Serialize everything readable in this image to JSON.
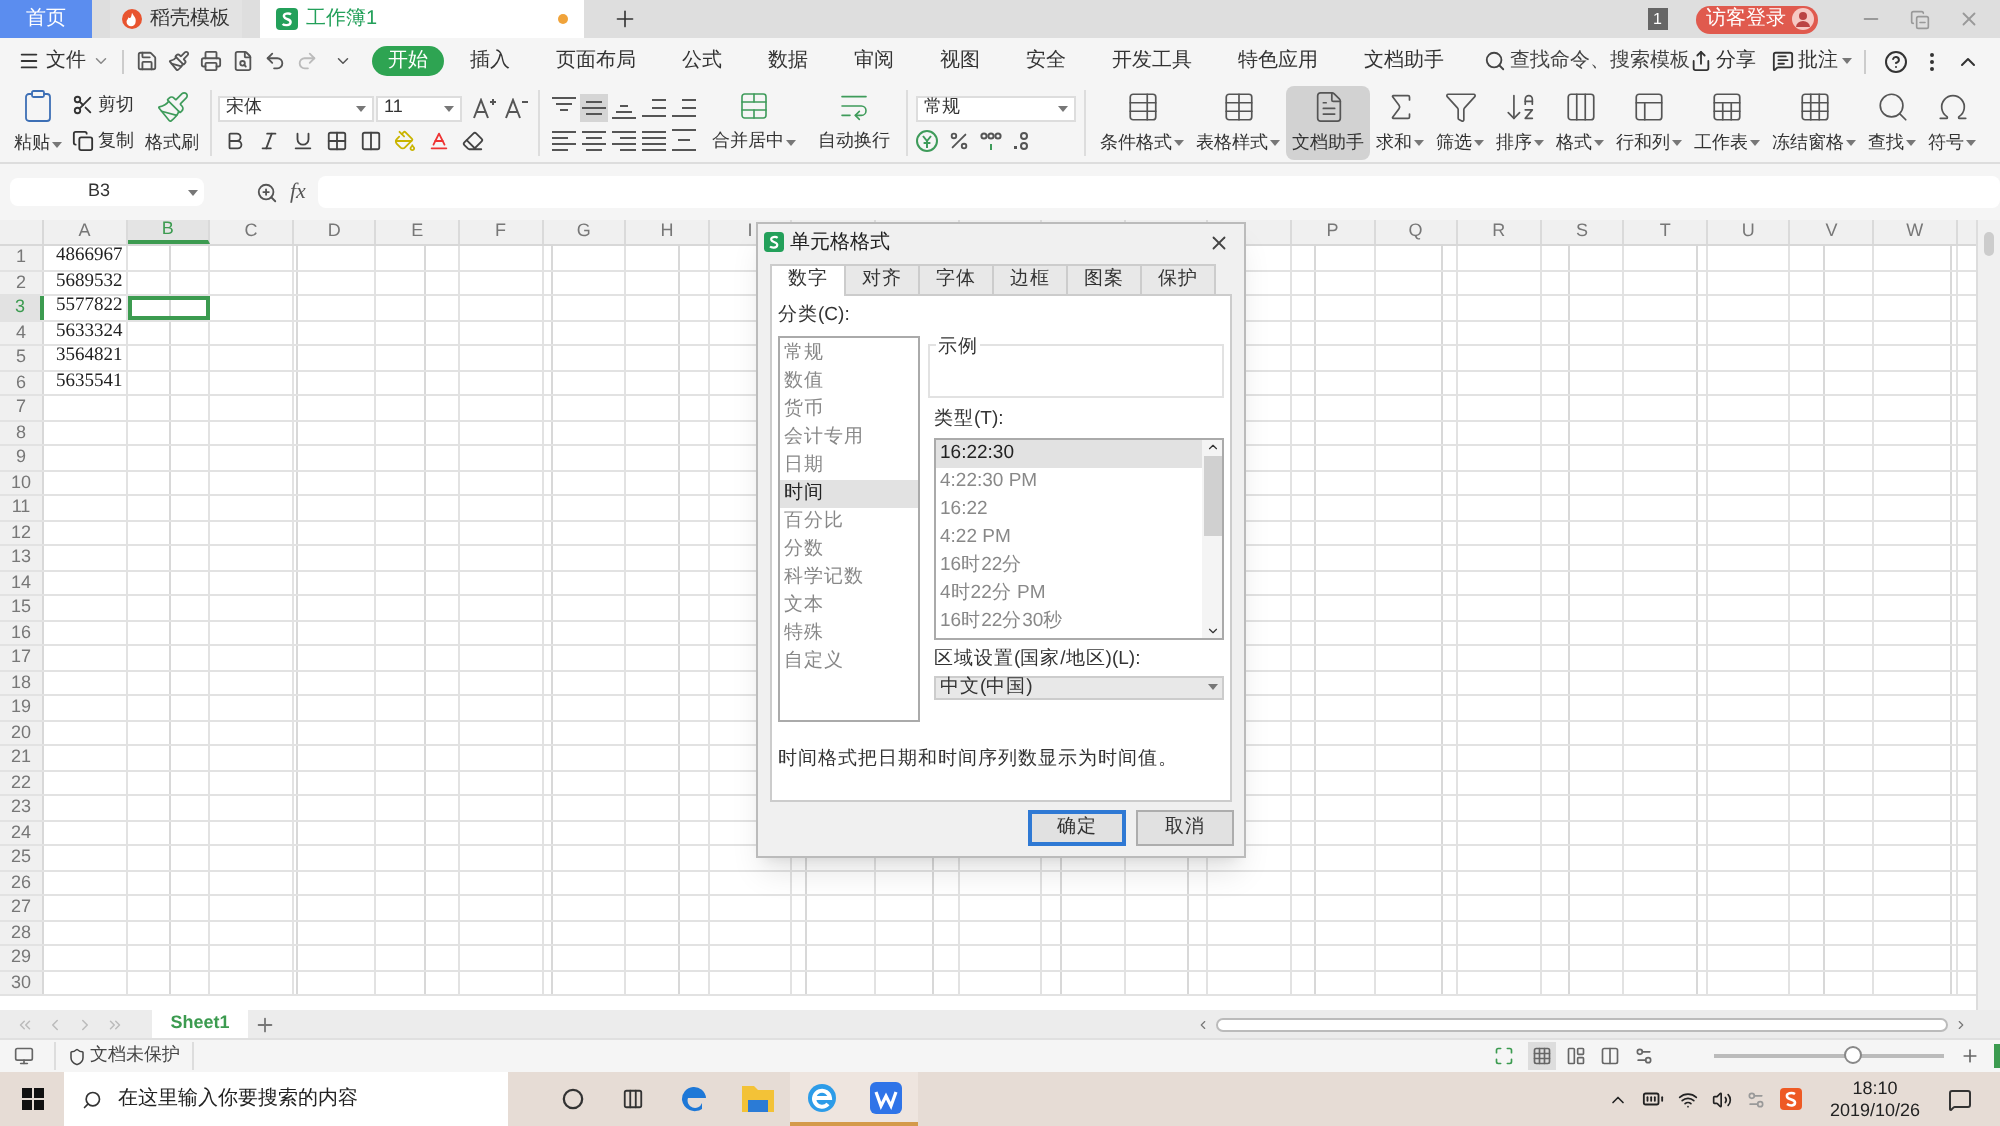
{
  "doc_tabs": [
    {
      "label": "首页",
      "kind": "home",
      "selected": false,
      "unsaved": false
    },
    {
      "label": "稻壳模板",
      "kind": "docer",
      "selected": false,
      "unsaved": false
    },
    {
      "label": "工作簿1",
      "kind": "sheet",
      "selected": true,
      "unsaved": true
    }
  ],
  "window_count": "1",
  "login": "访客登录",
  "menu": {
    "file": "文件",
    "search": "查找命令、搜索模板",
    "share": "分享",
    "comment": "批注",
    "tabs": [
      {
        "label": "开始",
        "selected": true
      },
      {
        "label": "插入",
        "selected": false
      },
      {
        "label": "页面布局",
        "selected": false
      },
      {
        "label": "公式",
        "selected": false
      },
      {
        "label": "数据",
        "selected": false
      },
      {
        "label": "审阅",
        "selected": false
      },
      {
        "label": "视图",
        "selected": false
      },
      {
        "label": "安全",
        "selected": false
      },
      {
        "label": "开发工具",
        "selected": false
      },
      {
        "label": "特色应用",
        "selected": false
      },
      {
        "label": "文档助手",
        "selected": false
      }
    ]
  },
  "ribbon": {
    "paste": {
      "label": "粘贴",
      "dropdown": true
    },
    "cut": "剪切",
    "copy": "复制",
    "format_painter": "格式刷",
    "font_name": "宋体",
    "font_size": "11",
    "align_buttons": [
      {
        "kind": "top",
        "selected": false
      },
      {
        "kind": "middle",
        "selected": true
      },
      {
        "kind": "bottom",
        "selected": false
      },
      {
        "kind": "outdent",
        "selected": false
      },
      {
        "kind": "indent",
        "selected": false
      },
      {
        "kind": "left",
        "selected": false
      },
      {
        "kind": "center",
        "selected": false
      },
      {
        "kind": "right",
        "selected": false
      },
      {
        "kind": "justify",
        "selected": false
      },
      {
        "kind": "distribute",
        "selected": false
      }
    ],
    "merge": [
      {
        "label": "合并居中",
        "kind": "merge",
        "dropdown": true
      },
      {
        "label": "自动换行",
        "kind": "wrap",
        "dropdown": false
      }
    ],
    "number_format": "常规",
    "tools": [
      {
        "label": "条件格式",
        "kind": "conditional",
        "dropdown": true,
        "selected": false
      },
      {
        "label": "表格样式",
        "kind": "table_style",
        "dropdown": true,
        "selected": false
      },
      {
        "label": "文档助手",
        "kind": "assistant",
        "dropdown": false,
        "selected": true
      },
      {
        "label": "求和",
        "kind": "sum",
        "dropdown": true,
        "selected": false
      },
      {
        "label": "筛选",
        "kind": "filter",
        "dropdown": true,
        "selected": false
      },
      {
        "label": "排序",
        "kind": "sort",
        "dropdown": true,
        "selected": false
      },
      {
        "label": "格式",
        "kind": "format",
        "dropdown": true,
        "selected": false
      },
      {
        "label": "行和列",
        "kind": "rowcol",
        "dropdown": true,
        "selected": false
      },
      {
        "label": "工作表",
        "kind": "sheet",
        "dropdown": true,
        "selected": false
      },
      {
        "label": "冻结窗格",
        "kind": "freeze",
        "dropdown": true,
        "selected": false
      },
      {
        "label": "查找",
        "kind": "find",
        "dropdown": true,
        "selected": false
      },
      {
        "label": "符号",
        "kind": "symbol",
        "dropdown": true,
        "selected": false
      }
    ]
  },
  "formula_bar": {
    "name_box": "B3",
    "fx": "fx"
  },
  "grid": {
    "column_groups": [
      [
        {
          "label": "A",
          "selected": false
        },
        {
          "label": "B",
          "selected": true
        },
        {
          "label": "C",
          "selected": false
        },
        {
          "label": "D",
          "selected": false
        },
        {
          "label": "E",
          "selected": false
        },
        {
          "label": "F",
          "selected": false
        },
        {
          "label": "G",
          "selected": false
        },
        {
          "label": "H",
          "selected": false
        },
        {
          "label": "I",
          "selected": false
        }
      ],
      [
        {
          "label": "P",
          "selected": false
        },
        {
          "label": "Q",
          "selected": false
        },
        {
          "label": "R",
          "selected": false
        },
        {
          "label": "S",
          "selected": false
        },
        {
          "label": "T",
          "selected": false
        },
        {
          "label": "U",
          "selected": false
        },
        {
          "label": "V",
          "selected": false
        },
        {
          "label": "W",
          "selected": false
        }
      ]
    ],
    "rows": [
      {
        "number": "1",
        "value": "4866967",
        "selected": false
      },
      {
        "number": "2",
        "value": "5689532",
        "selected": false
      },
      {
        "number": "3",
        "value": "5577822",
        "selected": true
      },
      {
        "number": "4",
        "value": "5633324",
        "selected": false
      },
      {
        "number": "5",
        "value": "3564821",
        "selected": false
      },
      {
        "number": "6",
        "value": "5635541",
        "selected": false
      },
      {
        "number": "7",
        "selected": false
      },
      {
        "number": "8",
        "selected": false
      },
      {
        "number": "9",
        "selected": false
      },
      {
        "number": "10",
        "selected": false
      },
      {
        "number": "11",
        "selected": false
      },
      {
        "number": "12",
        "selected": false
      },
      {
        "number": "13",
        "selected": false
      },
      {
        "number": "14",
        "selected": false
      },
      {
        "number": "15",
        "selected": false
      },
      {
        "number": "16",
        "selected": false
      },
      {
        "number": "17",
        "selected": false
      },
      {
        "number": "18",
        "selected": false
      },
      {
        "number": "19",
        "selected": false
      },
      {
        "number": "20",
        "selected": false
      },
      {
        "number": "21",
        "selected": false
      },
      {
        "number": "22",
        "selected": false
      },
      {
        "number": "23",
        "selected": false
      },
      {
        "number": "24",
        "selected": false
      },
      {
        "number": "25",
        "selected": false
      },
      {
        "number": "26",
        "selected": false
      },
      {
        "number": "27",
        "selected": false
      },
      {
        "number": "28",
        "selected": false
      },
      {
        "number": "29",
        "selected": false
      },
      {
        "number": "30",
        "selected": false
      }
    ]
  },
  "dialog": {
    "title": "单元格格式",
    "tabs": [
      {
        "label": "数字",
        "selected": true
      },
      {
        "label": "对齐",
        "selected": false
      },
      {
        "label": "字体",
        "selected": false
      },
      {
        "label": "边框",
        "selected": false
      },
      {
        "label": "图案",
        "selected": false
      },
      {
        "label": "保护",
        "selected": false
      }
    ],
    "category_label": "分类(C):",
    "categories": [
      {
        "label": "常规",
        "selected": false
      },
      {
        "label": "数值",
        "selected": false
      },
      {
        "label": "货币",
        "selected": false
      },
      {
        "label": "会计专用",
        "selected": false
      },
      {
        "label": "日期",
        "selected": false
      },
      {
        "label": "时间",
        "selected": true
      },
      {
        "label": "百分比",
        "selected": false
      },
      {
        "label": "分数",
        "selected": false
      },
      {
        "label": "科学记数",
        "selected": false
      },
      {
        "label": "文本",
        "selected": false
      },
      {
        "label": "特殊",
        "selected": false
      },
      {
        "label": "自定义",
        "selected": false
      }
    ],
    "sample_label": "示例",
    "type_label": "类型(T):",
    "types": [
      {
        "label": "16:22:30",
        "selected": true
      },
      {
        "label": "4:22:30 PM",
        "selected": false
      },
      {
        "label": "16:22",
        "selected": false
      },
      {
        "label": "4:22 PM",
        "selected": false
      },
      {
        "label": "16时22分",
        "selected": false
      },
      {
        "label": "4时22分 PM",
        "selected": false
      },
      {
        "label": "16时22分30秒",
        "selected": false
      }
    ],
    "locale_label": "区域设置(国家/地区)(L):",
    "locale": "中文(中国)",
    "description": "时间格式把日期和时间序列数显示为时间值。",
    "buttons": [
      {
        "label": "确定",
        "kind": "primary"
      },
      {
        "label": "取消",
        "kind": "secondary"
      }
    ]
  },
  "sheets": [
    {
      "label": "Sheet1",
      "selected": true
    }
  ],
  "status": {
    "protection": "文档未保护",
    "zoom": {
      "level": 0.6
    }
  },
  "taskbar": {
    "search_placeholder": "在这里输入你要搜索的内容",
    "time": "18:10",
    "date": "2019/10/26",
    "apps": [
      {
        "kind": "edge",
        "running": false
      },
      {
        "kind": "explorer",
        "running": false
      },
      {
        "kind": "ie",
        "running": true
      },
      {
        "kind": "wps",
        "running": true
      }
    ]
  }
}
